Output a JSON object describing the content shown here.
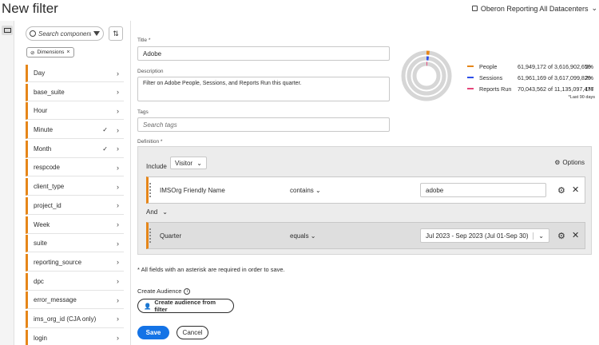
{
  "header": {
    "title": "New filter",
    "datacenter": "Oberon Reporting All Datacenters"
  },
  "left_panel": {
    "search_placeholder": "Search components",
    "chip_label": "Dimensions",
    "items": [
      {
        "label": "Day",
        "checked": false
      },
      {
        "label": "base_suite",
        "checked": false
      },
      {
        "label": "Hour",
        "checked": false
      },
      {
        "label": "Minute",
        "checked": true
      },
      {
        "label": "Month",
        "checked": true
      },
      {
        "label": "respcode",
        "checked": false
      },
      {
        "label": "client_type",
        "checked": false
      },
      {
        "label": "project_id",
        "checked": false
      },
      {
        "label": "Week",
        "checked": false
      },
      {
        "label": "suite",
        "checked": false
      },
      {
        "label": "reporting_source",
        "checked": false
      },
      {
        "label": "dpc",
        "checked": false
      },
      {
        "label": "error_message",
        "checked": false
      },
      {
        "label": "ims_org_id (CJA only)",
        "checked": false
      },
      {
        "label": "login",
        "checked": false
      }
    ]
  },
  "form": {
    "title_label": "Title *",
    "title_value": "Adobe",
    "description_label": "Description",
    "description_value": "Filter on Adobe People, Sessions, and Reports Run this quarter.",
    "tags_label": "Tags",
    "tags_placeholder": "Search tags",
    "definition_label": "Definition *"
  },
  "summary": {
    "rows": [
      {
        "name": "People",
        "value": "61,949,172 of 3,616,902,650",
        "pct": "2%",
        "color": "#e68619"
      },
      {
        "name": "Sessions",
        "value": "61,961,169 of 3,617,099,820",
        "pct": "2%",
        "color": "#2d4fe8"
      },
      {
        "name": "Reports Run",
        "value": "70,043,562 of 11,135,097,477",
        "pct": "1%",
        "color": "#e5457a"
      }
    ],
    "note": "*Last 90 days",
    "ring_colors": {
      "base": "#d6d6d6"
    }
  },
  "definition": {
    "include_label": "Include",
    "container": "Visitor",
    "options_label": "Options",
    "rules": [
      {
        "name": "IMSOrg Friendly Name",
        "operator": "contains",
        "value": "adobe"
      },
      {
        "name": "Quarter",
        "operator": "equals",
        "value": "Jul 2023 - Sep 2023 (Jul 01-Sep 30)"
      }
    ],
    "and_label": "And"
  },
  "footer": {
    "required_note": "* All fields with an asterisk are required in order to save.",
    "create_audience_label": "Create Audience",
    "create_audience_button": "Create audience from filter",
    "save_label": "Save",
    "cancel_label": "Cancel"
  }
}
